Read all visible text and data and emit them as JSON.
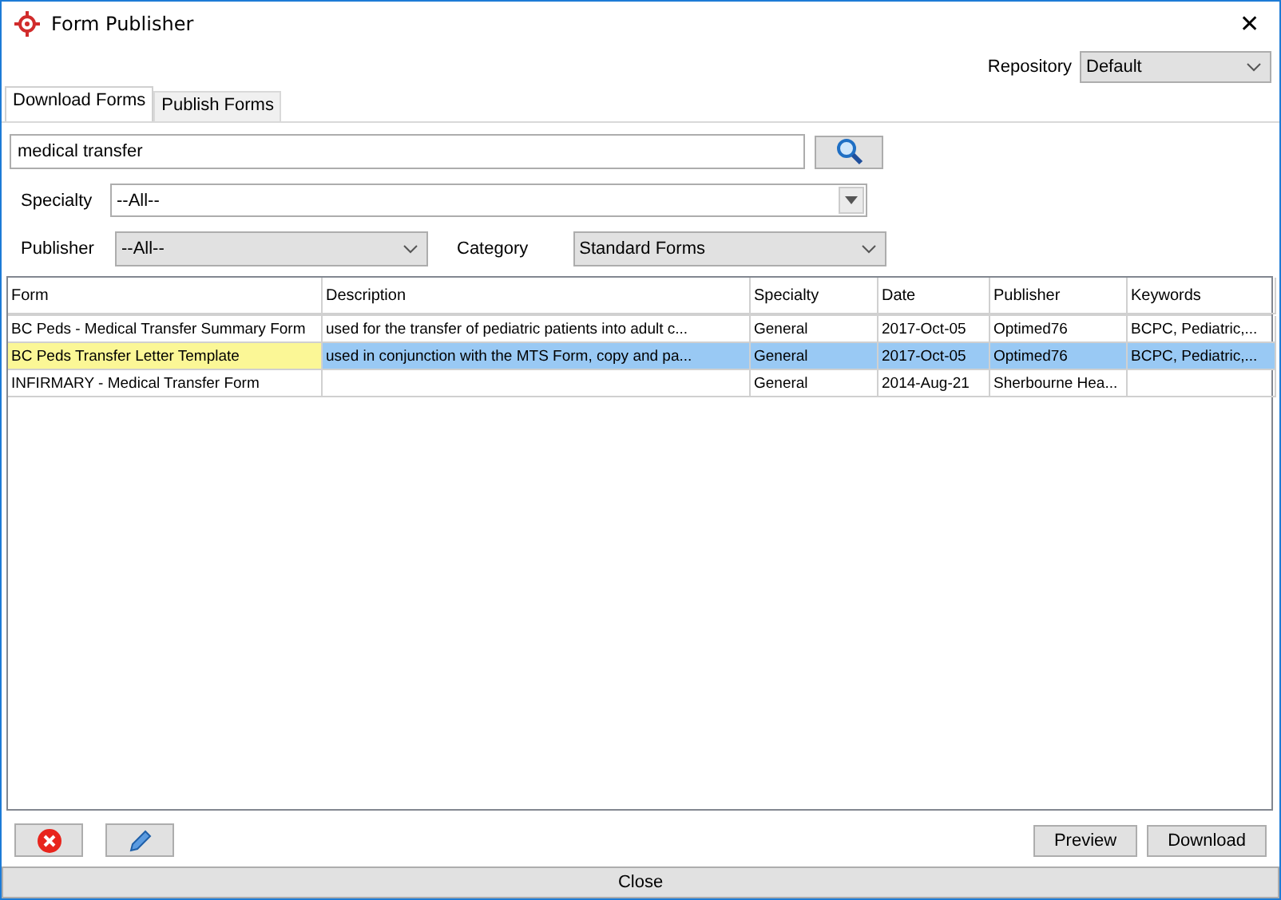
{
  "window": {
    "title": "Form Publisher",
    "close": "✕"
  },
  "repository": {
    "label": "Repository",
    "value": "Default"
  },
  "tabs": [
    {
      "label": "Download Forms",
      "selected": true
    },
    {
      "label": "Publish Forms",
      "selected": false
    }
  ],
  "search": {
    "value": "medical transfer"
  },
  "specialty": {
    "label": "Specialty",
    "value": "--All--"
  },
  "publisher": {
    "label": "Publisher",
    "value": "--All--"
  },
  "category": {
    "label": "Category",
    "value": "Standard Forms"
  },
  "table": {
    "columns": [
      "Form",
      "Description",
      "Specialty",
      "Date",
      "Publisher",
      "Keywords"
    ],
    "rows": [
      {
        "cells": [
          "BC Peds - Medical Transfer Summary Form",
          "used for the transfer of pediatric patients into adult c...",
          "General",
          "2017-Oct-05",
          "Optimed76",
          "BCPC, Pediatric,..."
        ],
        "selected": false,
        "focused": false
      },
      {
        "cells": [
          "BC Peds Transfer Letter Template",
          "used in conjunction with the MTS Form, copy and pa...",
          "General",
          "2017-Oct-05",
          "Optimed76",
          "BCPC, Pediatric,..."
        ],
        "selected": true,
        "focused": true
      },
      {
        "cells": [
          "INFIRMARY - Medical Transfer Form",
          "",
          "General",
          "2014-Aug-21",
          "Sherbourne Hea...",
          ""
        ],
        "selected": false,
        "focused": false
      }
    ]
  },
  "buttons": [
    "Preview",
    "Download"
  ],
  "close_button": "Close"
}
